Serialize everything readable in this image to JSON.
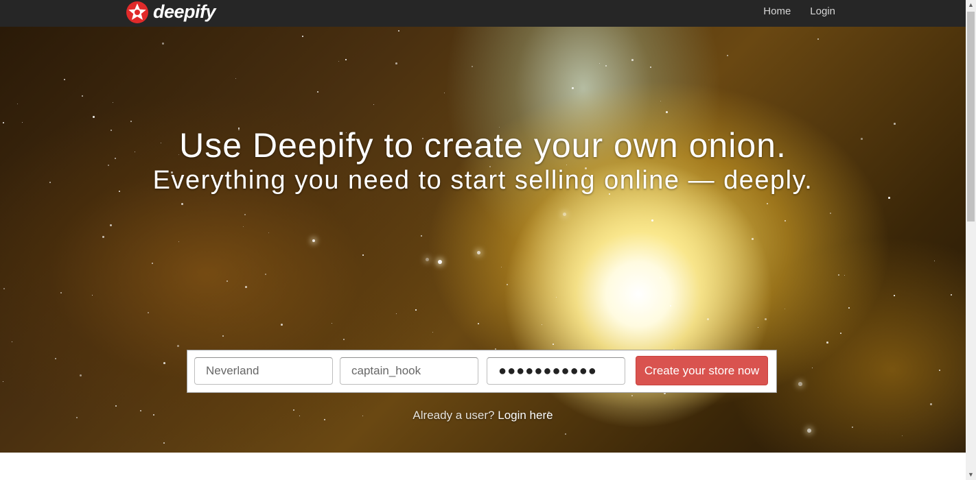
{
  "header": {
    "brand_name": "deepify",
    "logo_icon": "red-star-badge-icon",
    "nav": [
      {
        "label": "Home"
      },
      {
        "label": "Login"
      }
    ]
  },
  "hero": {
    "headline": "Use Deepify to create your own onion.",
    "subheadline": "Everything you need to start selling online — deeply."
  },
  "signup_form": {
    "store_name_value": "Neverland",
    "username_value": "captain_hook",
    "password_value": "●●●●●●●●●●●",
    "submit_label": "Create your store now"
  },
  "login_prompt": {
    "text": "Already a user?",
    "link_label": "Login here"
  },
  "colors": {
    "topbar": "#262626",
    "accent": "#d9534f"
  }
}
